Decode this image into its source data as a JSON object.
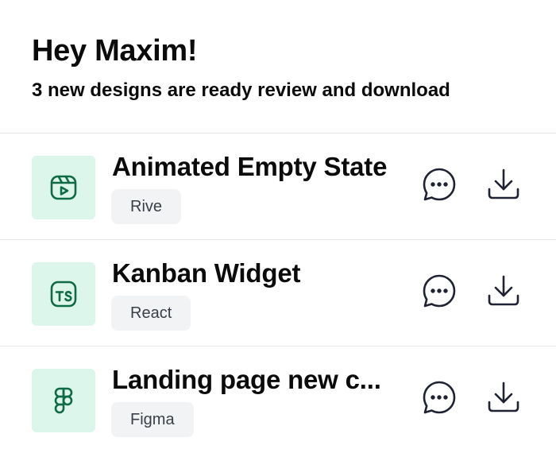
{
  "header": {
    "greeting": "Hey Maxim!",
    "subtitle": "3 new designs are ready review and download"
  },
  "items": [
    {
      "title": "Animated Empty State",
      "tag": "Rive",
      "icon": "rive-video-icon"
    },
    {
      "title": "Kanban Widget",
      "tag": "React",
      "icon": "typescript-icon"
    },
    {
      "title": "Landing page new c...",
      "tag": "Figma",
      "icon": "figma-icon"
    }
  ],
  "colors": {
    "thumb_bg": "#dcf6eb",
    "thumb_icon": "#0f6b45",
    "tag_bg": "#f1f3f5",
    "action_icon": "#1e2233",
    "divider": "#e5e7eb"
  }
}
